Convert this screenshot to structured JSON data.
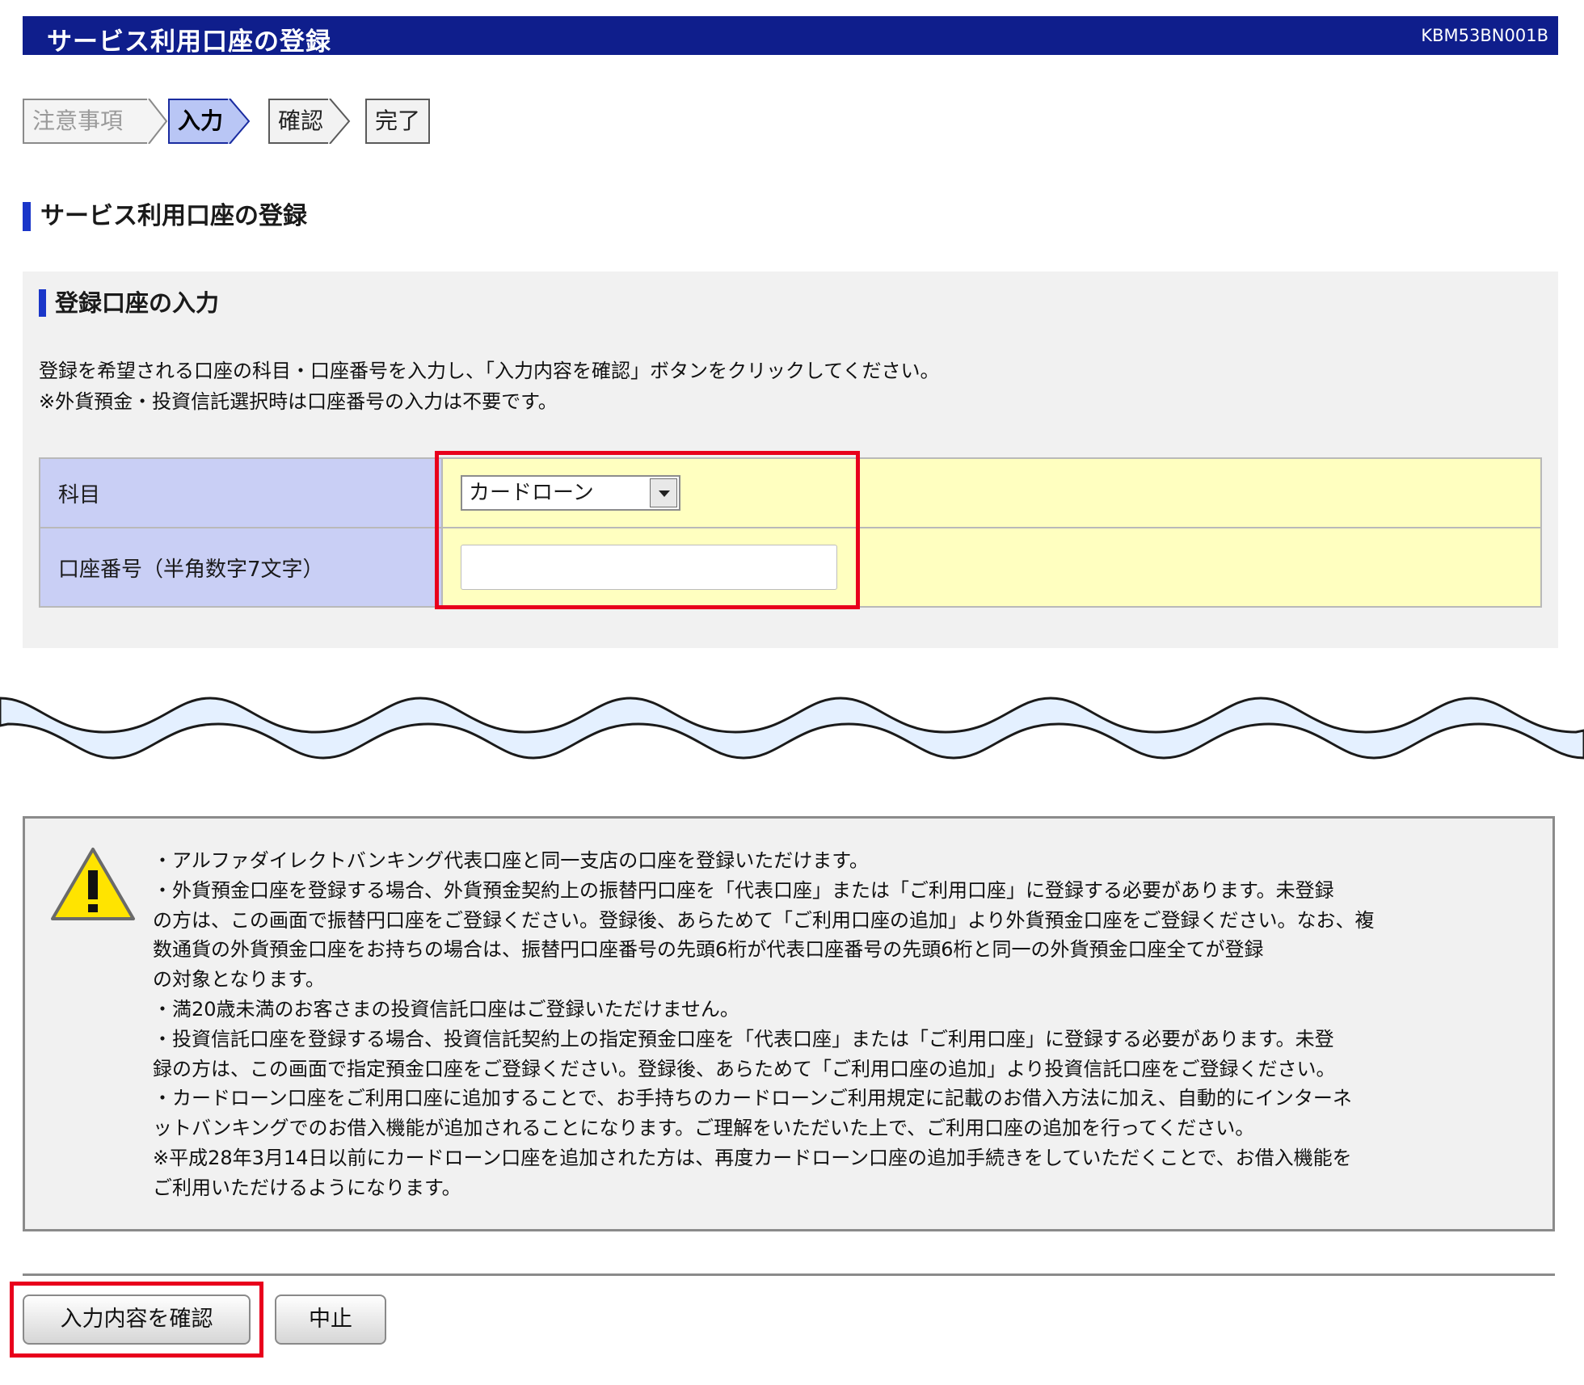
{
  "header": {
    "title": "サービス利用口座の登録",
    "screen_id": "KBM53BN001B"
  },
  "steps": [
    {
      "label": "注意事項",
      "state": "done"
    },
    {
      "label": "入力",
      "state": "active"
    },
    {
      "label": "確認",
      "state": "todo"
    },
    {
      "label": "完了",
      "state": "todo"
    }
  ],
  "page_title": "サービス利用口座の登録",
  "form": {
    "section_title": "登録口座の入力",
    "instructions": [
      "登録を希望される口座の科目・口座番号を入力し、「入力内容を確認」ボタンをクリックしてください。",
      "※外貨預金・投資信託選択時は口座番号の入力は不要です。"
    ],
    "rows": {
      "subject_label": "科目",
      "subject_value": "カードローン",
      "account_label": "口座番号（半角数字7文字）",
      "account_value": ""
    }
  },
  "notice": {
    "lines": [
      "・アルファダイレクトバンキング代表口座と同一支店の口座を登録いただけます。",
      "・外貨預金口座を登録する場合、外貨預金契約上の振替円口座を「代表口座」または「ご利用口座」に登録する必要があります。未登録",
      "の方は、この画面で振替円口座をご登録ください。登録後、あらためて「ご利用口座の追加」より外貨預金口座をご登録ください。なお、複",
      "数通貨の外貨預金口座をお持ちの場合は、振替円口座番号の先頭6桁が代表口座番号の先頭6桁と同一の外貨預金口座全てが登録",
      "の対象となります。",
      "・満20歳未満のお客さまの投資信託口座はご登録いただけません。",
      "・投資信託口座を登録する場合、投資信託契約上の指定預金口座を「代表口座」または「ご利用口座」に登録する必要があります。未登",
      "録の方は、この画面で指定預金口座をご登録ください。登録後、あらためて「ご利用口座の追加」より投資信託口座をご登録ください。",
      "・カードローン口座をご利用口座に追加することで、お手持ちのカードローンご利用規定に記載のお借入方法に加え、自動的にインターネ",
      "ットバンキングでのお借入機能が追加されることになります。ご理解をいただいた上で、ご利用口座の追加を行ってください。",
      "※平成28年3月14日以前にカードローン口座を追加された方は、再度カードローン口座の追加手続きをしていただくことで、お借入機能を",
      "ご利用いただけるようになります。"
    ]
  },
  "buttons": {
    "confirm": "入力内容を確認",
    "cancel": "中止"
  },
  "colors": {
    "header": "#0f1e8c",
    "highlight": "#e8001c",
    "label_bg": "#c9cff5",
    "field_bg": "#ffffc0",
    "wave": "#e4f0ff"
  },
  "icons": {
    "notice": "warning-icon"
  }
}
